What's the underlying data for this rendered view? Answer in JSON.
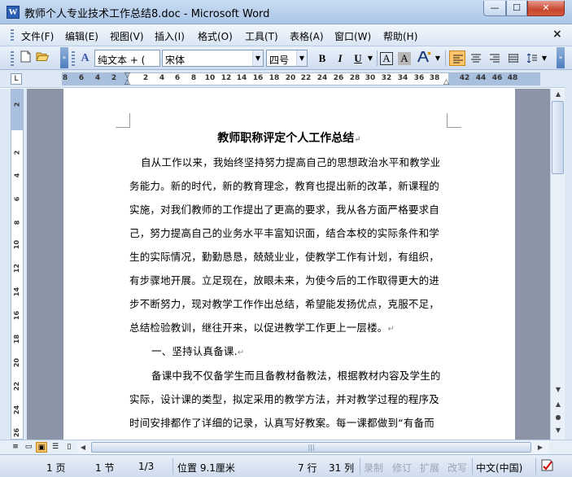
{
  "window": {
    "title": "教师个人专业技术工作总结8.doc - Microsoft Word",
    "app_icon": "W",
    "min_icon": "—",
    "max_icon": "☐",
    "close_icon": "✕"
  },
  "menu": {
    "items": [
      "文件(F)",
      "编辑(E)",
      "视图(V)",
      "插入(I)",
      "格式(O)",
      "工具(T)",
      "表格(A)",
      "窗口(W)",
      "帮助(H)"
    ],
    "doc_close": "×"
  },
  "toolbar": {
    "style": "纯文本 + (",
    "font": "宋体",
    "size": "四号",
    "bold": "B",
    "italic": "I",
    "underline": "U",
    "char_border": "A",
    "char_shade": "A",
    "style_icon": "A"
  },
  "ruler": {
    "corner": "L",
    "numbers": [
      "8",
      "6",
      "4",
      "2",
      "2",
      "4",
      "6",
      "8",
      "10",
      "12",
      "14",
      "16",
      "18",
      "20",
      "22",
      "24",
      "26",
      "28",
      "30",
      "32",
      "34",
      "36",
      "38",
      "42",
      "44",
      "46",
      "48"
    ],
    "vertical_numbers": [
      "2",
      "2",
      "4",
      "6",
      "8",
      "10",
      "12",
      "14",
      "16",
      "18",
      "20",
      "22",
      "24",
      "26"
    ]
  },
  "document": {
    "title": "教师职称评定个人工作总结",
    "lines": [
      "自从工作以来，我始终坚持努力提高自己的思想政治水平和教学业",
      "务能力。新的时代，新的教育理念，教育也提出新的改革，新课程的",
      "实施，对我们教师的工作提出了更高的要求，我从各方面严格要求自",
      "己，努力提高自己的业务水平丰富知识面，结合本校的实际条件和学",
      "生的实际情况，勤勤恳恳，兢兢业业，使教学工作有计划，有组织，",
      "有步骤地开展。立足现在，放眼未来，为使今后的工作取得更大的进",
      "步不断努力，现对教学工作作出总结，希望能发扬优点，克服不足，",
      "总结检验教训，继往开来，以促进教学工作更上一层楼。",
      "一、坚持认真备课.",
      "备课中我不仅备学生而且备教材备教法，根据教材内容及学生的",
      "实际，设计课的类型，拟定采用的教学方法，并对教学过程的程序及",
      "时间安排都作了详细的记录，认真写好教案。每一课都做到“有备而"
    ],
    "paragraph_mark": "↵"
  },
  "status": {
    "page": "1 页",
    "section": "1 节",
    "page_of": "1/3",
    "position": "位置 9.1厘米",
    "line": "7 行",
    "column": "31 列",
    "rec": "录制",
    "trk": "修订",
    "ext": "扩展",
    "ovr": "改写",
    "language": "中文(中国)"
  }
}
